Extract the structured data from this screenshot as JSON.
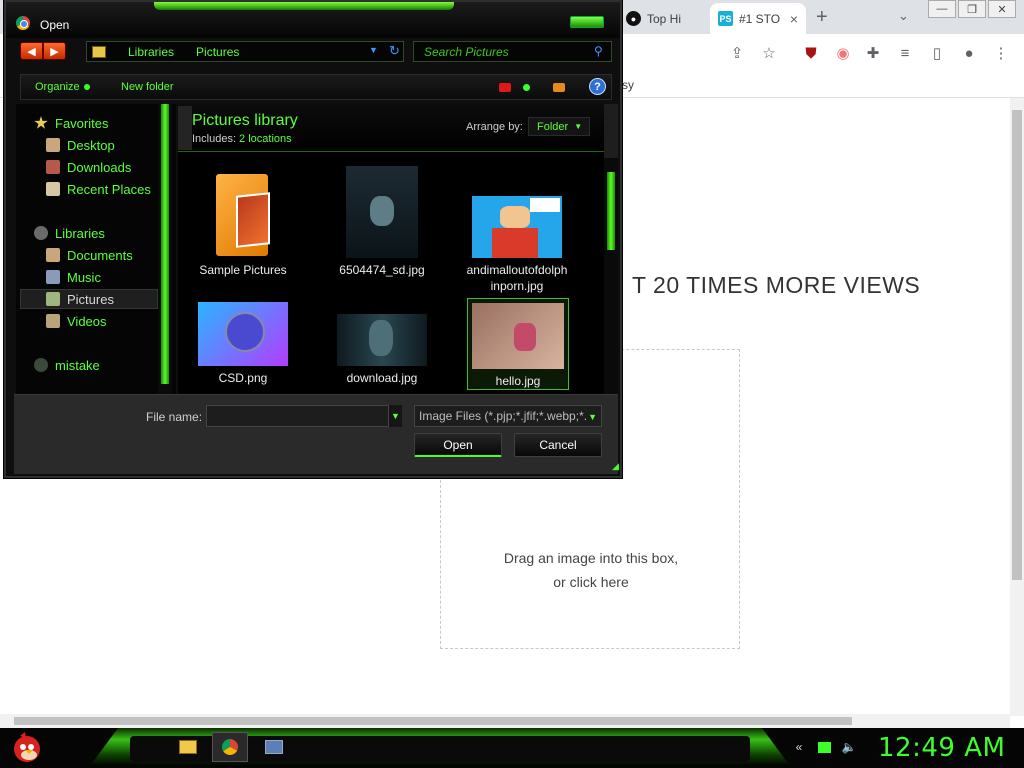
{
  "browser": {
    "tabs": [
      {
        "label": "Top Hi",
        "favicon": "dark-circle-icon"
      },
      {
        "label": "#1 STO",
        "favicon": "PS"
      }
    ],
    "new_tab": "+",
    "bookmark_fragment": "sy",
    "headline": "T 20 TIMES MORE VIEWS",
    "drop_line1": "Drag an image into this box,",
    "drop_line2": "or click here"
  },
  "dialog": {
    "title": "Open",
    "breadcrumb": [
      "Libraries",
      "Pictures"
    ],
    "search_placeholder": "Search Pictures",
    "toolbar": {
      "organize": "Organize",
      "new_folder": "New folder",
      "help": "?"
    },
    "nav": {
      "favorites": "Favorites",
      "desktop": "Desktop",
      "downloads": "Downloads",
      "recent": "Recent Places",
      "libraries": "Libraries",
      "documents": "Documents",
      "music": "Music",
      "pictures": "Pictures",
      "videos": "Videos",
      "mistake": "mistake"
    },
    "library": {
      "title": "Pictures library",
      "includes_label": "Includes:",
      "locations": "2 locations",
      "arrange_label": "Arrange by:",
      "arrange_value": "Folder"
    },
    "files": [
      {
        "name": "Sample Pictures"
      },
      {
        "name": "6504474_sd.jpg"
      },
      {
        "name": "andimalloutofdolphinporn.jpg"
      },
      {
        "name": "CSD.png"
      },
      {
        "name": "download.jpg"
      },
      {
        "name": "hello.jpg"
      }
    ],
    "filename_label": "File name:",
    "filename_value": "",
    "filetype": "Image Files (*.pjp;*.jfif;*.webp;*.",
    "open_label": "Open",
    "cancel_label": "Cancel"
  },
  "taskbar": {
    "clock": "12:49 AM"
  },
  "colors": {
    "accent_green": "#5cff3c",
    "dialog_bg": "#0e0e0e"
  }
}
